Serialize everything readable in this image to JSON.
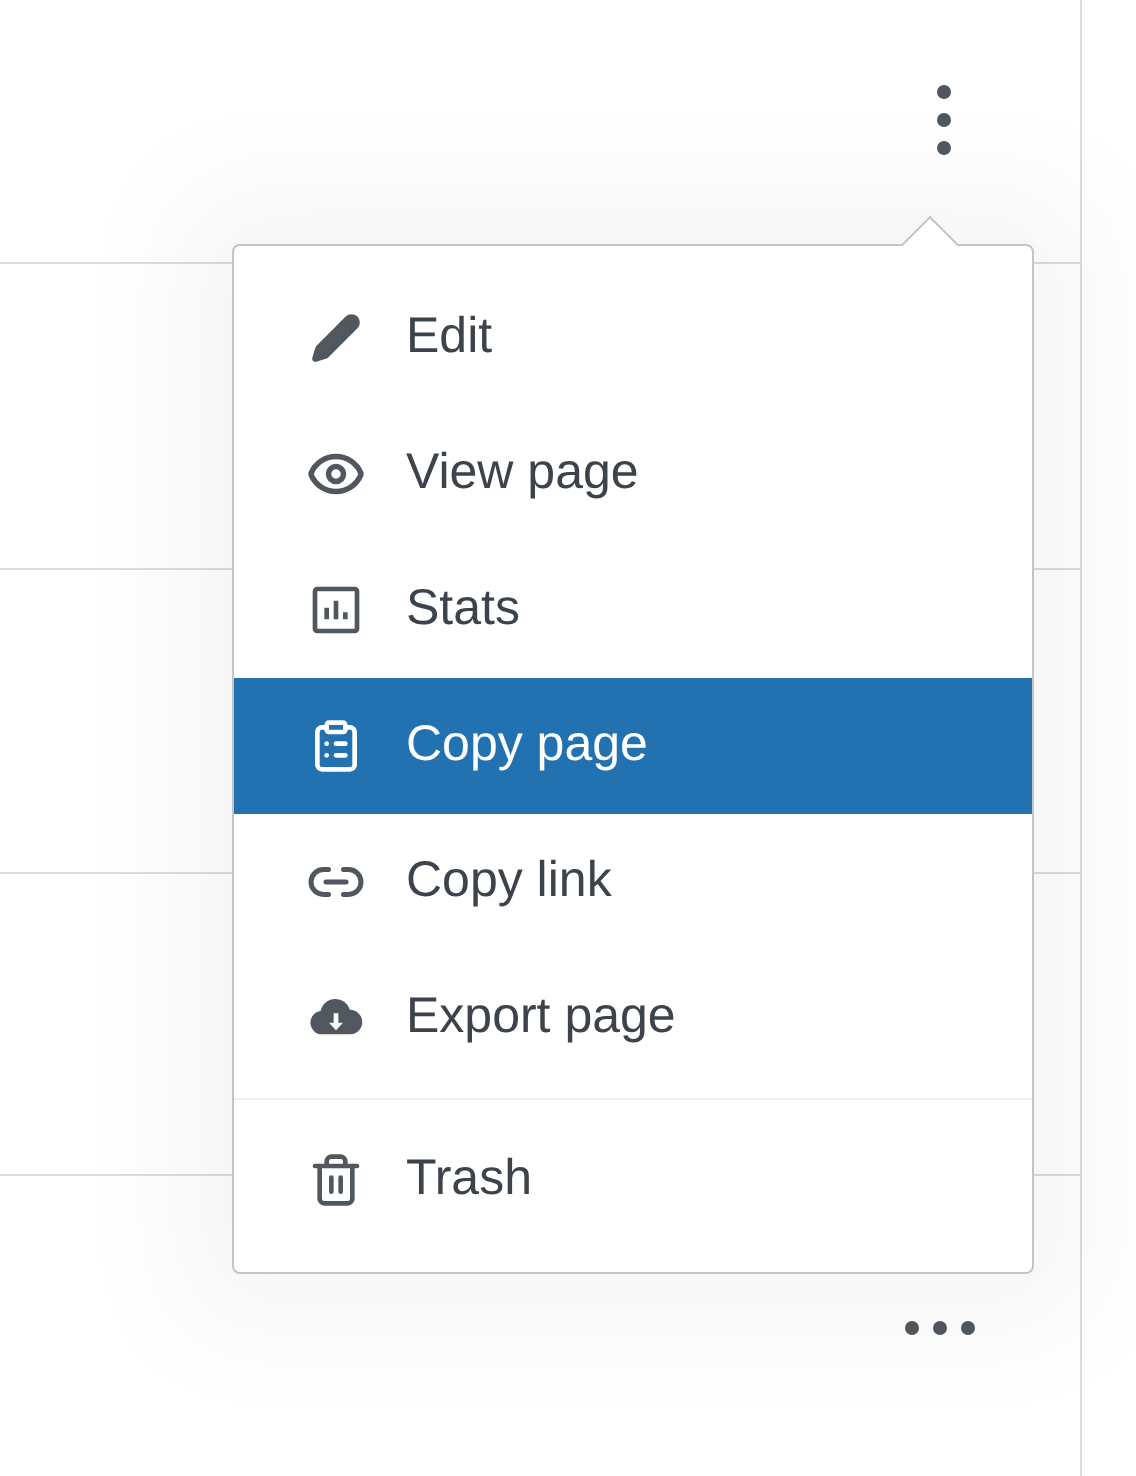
{
  "menu": {
    "groups": [
      [
        {
          "label": "Edit",
          "selected": false
        },
        {
          "label": "View page",
          "selected": false
        },
        {
          "label": "Stats",
          "selected": false
        },
        {
          "label": "Copy page",
          "selected": true
        },
        {
          "label": "Copy link",
          "selected": false
        },
        {
          "label": "Export page",
          "selected": false
        }
      ],
      [
        {
          "label": "Trash",
          "selected": false
        }
      ]
    ]
  }
}
